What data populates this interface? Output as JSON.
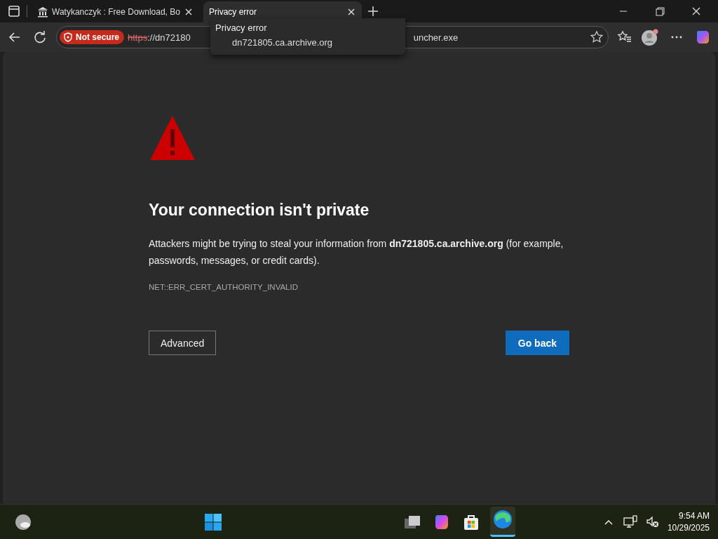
{
  "tabs": [
    {
      "title": "Watykanczyk : Free Download, Bo",
      "selected": false
    },
    {
      "title": "Privacy error",
      "selected": true
    }
  ],
  "address_bar": {
    "security": "Not secure",
    "scheme": "https",
    "url_start": "://dn72180",
    "url_end": "uncher.exe"
  },
  "tab_tooltip": {
    "title": "Privacy error",
    "host": "dn721805.ca.archive.org"
  },
  "error_page": {
    "heading": "Your connection isn't private",
    "message": "Attackers might be trying to steal your information from **dn721805.ca.archive.org** (for example, passwords, messages, or credit cards).",
    "error_code": "NET::ERR_CERT_AUTHORITY_INVALID",
    "buttons": [
      {
        "label": "Advanced",
        "kind": "secondary"
      },
      {
        "label": "Go back",
        "kind": "primary"
      }
    ]
  },
  "taskbar": {
    "time": "9:54 AM",
    "date": "10/29/2025"
  }
}
